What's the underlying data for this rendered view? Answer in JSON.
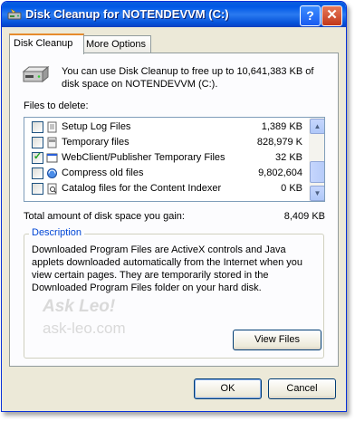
{
  "window": {
    "title": "Disk Cleanup for NOTENDEVVM (C:)",
    "help_glyph": "?",
    "close_glyph": "✕"
  },
  "tabs": [
    {
      "label": "Disk Cleanup",
      "active": true
    },
    {
      "label": "More Options",
      "active": false
    }
  ],
  "intro": "You can use Disk Cleanup to free up to 10,641,383 KB of disk space on NOTENDEVVM (C:).",
  "files_label": "Files to delete:",
  "files": [
    {
      "name": "Setup Log Files",
      "size": "1,389 KB",
      "checked": false,
      "icon": "log-file-icon"
    },
    {
      "name": "Temporary files",
      "size": "828,979 K",
      "checked": false,
      "icon": "temp-file-icon"
    },
    {
      "name": "WebClient/Publisher Temporary Files",
      "size": "32 KB",
      "checked": true,
      "icon": "webclient-icon"
    },
    {
      "name": "Compress old files",
      "size": "9,802,604",
      "checked": false,
      "icon": "compress-icon"
    },
    {
      "name": "Catalog files for the Content Indexer",
      "size": "0 KB",
      "checked": false,
      "icon": "catalog-icon"
    }
  ],
  "total_label": "Total amount of disk space you gain:",
  "total_value": "8,409 KB",
  "description": {
    "title": "Description",
    "text": "Downloaded Program Files are ActiveX controls and Java applets downloaded automatically from the Internet when you view certain pages. They are temporarily stored in the Downloaded Program Files folder on your hard disk."
  },
  "watermark": {
    "line1": "Ask Leo!",
    "line2": "ask-leo.com"
  },
  "buttons": {
    "view_files": "View Files",
    "ok": "OK",
    "cancel": "Cancel"
  },
  "colors": {
    "title_bar": "#0058e6",
    "dialog_bg": "#ece9d8",
    "active_tab_accent": "#e68b2c",
    "description_title": "#0046d5"
  }
}
